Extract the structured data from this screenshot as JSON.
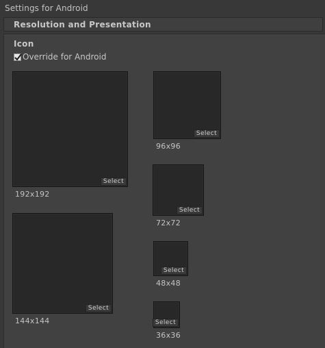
{
  "window": {
    "title": "Settings for Android"
  },
  "section": {
    "title": "Resolution and Presentation"
  },
  "icon_panel": {
    "heading": "Icon",
    "override_label": "Override for Android",
    "override_checked": true,
    "select_label": "Select",
    "slots": [
      {
        "size": "192x192"
      },
      {
        "size": "144x144"
      },
      {
        "size": "96x96"
      },
      {
        "size": "72x72"
      },
      {
        "size": "48x48"
      },
      {
        "size": "36x36"
      }
    ]
  }
}
